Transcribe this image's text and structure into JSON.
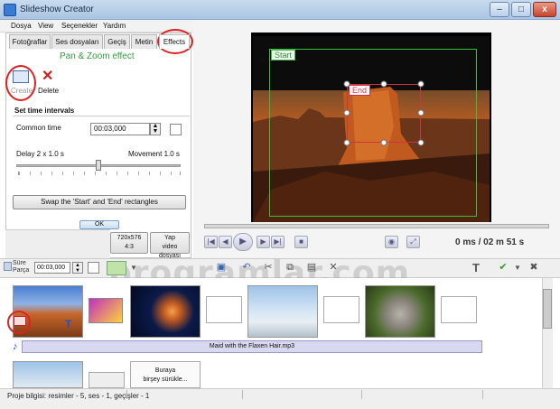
{
  "window": {
    "title": "Slideshow Creator",
    "min": "–",
    "max": "□",
    "close": "x"
  },
  "menu": [
    "Dosya",
    "View",
    "Seçenekler",
    "Yardım"
  ],
  "tabs": [
    "Fotoğraflar",
    "Ses dosyaları",
    "Geçiş",
    "Metin",
    "Effects"
  ],
  "panel": {
    "heading": "Pan & Zoom effect",
    "create_label": "Create",
    "delete_label": "Delete",
    "section_title": "Set time intervals",
    "common_time_label": "Common time",
    "common_time_value": "00:03,000",
    "delay_label": "Delay 2 x 1.0 s",
    "movement_label": "Movement 1.0 s",
    "swap_button": "Swap the 'Start' and 'End' rectangles",
    "ok_button": "OK"
  },
  "size_buttons": {
    "res": "720x576",
    "ratio": "4:3",
    "yap1": "Yap",
    "yap2": "video dosyası"
  },
  "preview": {
    "start_label": "Start",
    "end_label": "End",
    "time": "0 ms  / 02 m 51 s"
  },
  "toolbar": {
    "sure1": "Süre",
    "sure2": "Parça",
    "duration": "00:03,000"
  },
  "watermark": "programlar.com",
  "storyboard": {
    "audio": "Maid with the Flaxen Hair.mp3",
    "drop1": "Buraya",
    "drop2": "birşey sürükle..."
  },
  "status": "Proje bilgisi: resimler - 5, ses - 1, geçişler - 1",
  "colors": {
    "accent": "#2f9e3a",
    "highlight_circle": "#dd2222",
    "start_rect": "#3cbf3c",
    "end_rect": "#cc3344"
  }
}
